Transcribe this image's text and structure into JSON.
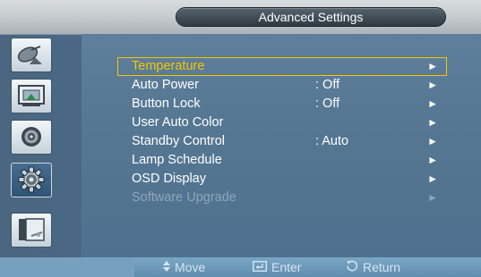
{
  "header": {
    "title": "Advanced Settings"
  },
  "sidebar": {
    "items": [
      {
        "icon": "satellite-dish-icon"
      },
      {
        "icon": "picture-icon"
      },
      {
        "icon": "speaker-icon"
      },
      {
        "icon": "gear-icon",
        "active": true
      },
      {
        "icon": "support-book-icon"
      }
    ]
  },
  "menu": {
    "items": [
      {
        "label": "Temperature",
        "value": "",
        "selected": true,
        "enabled": true
      },
      {
        "label": "Auto Power",
        "value": ": Off",
        "enabled": true
      },
      {
        "label": "Button Lock",
        "value": ": Off",
        "enabled": true
      },
      {
        "label": "User Auto Color",
        "value": "",
        "enabled": true
      },
      {
        "label": "Standby Control",
        "value": ": Auto",
        "enabled": true
      },
      {
        "label": "Lamp Schedule",
        "value": "",
        "enabled": true
      },
      {
        "label": "OSD Display",
        "value": "",
        "enabled": true
      },
      {
        "label": "Software Upgrade",
        "value": "",
        "enabled": false
      }
    ],
    "arrow_glyph": "►"
  },
  "footer": {
    "move": "Move",
    "enter": "Enter",
    "return": "Return",
    "move_icon": "up-down-icon",
    "enter_icon": "enter-icon",
    "return_icon": "return-icon"
  },
  "colors": {
    "accent": "#f6c700",
    "panel": "#5a7b98",
    "disabled_text": "#8ea5b9"
  }
}
